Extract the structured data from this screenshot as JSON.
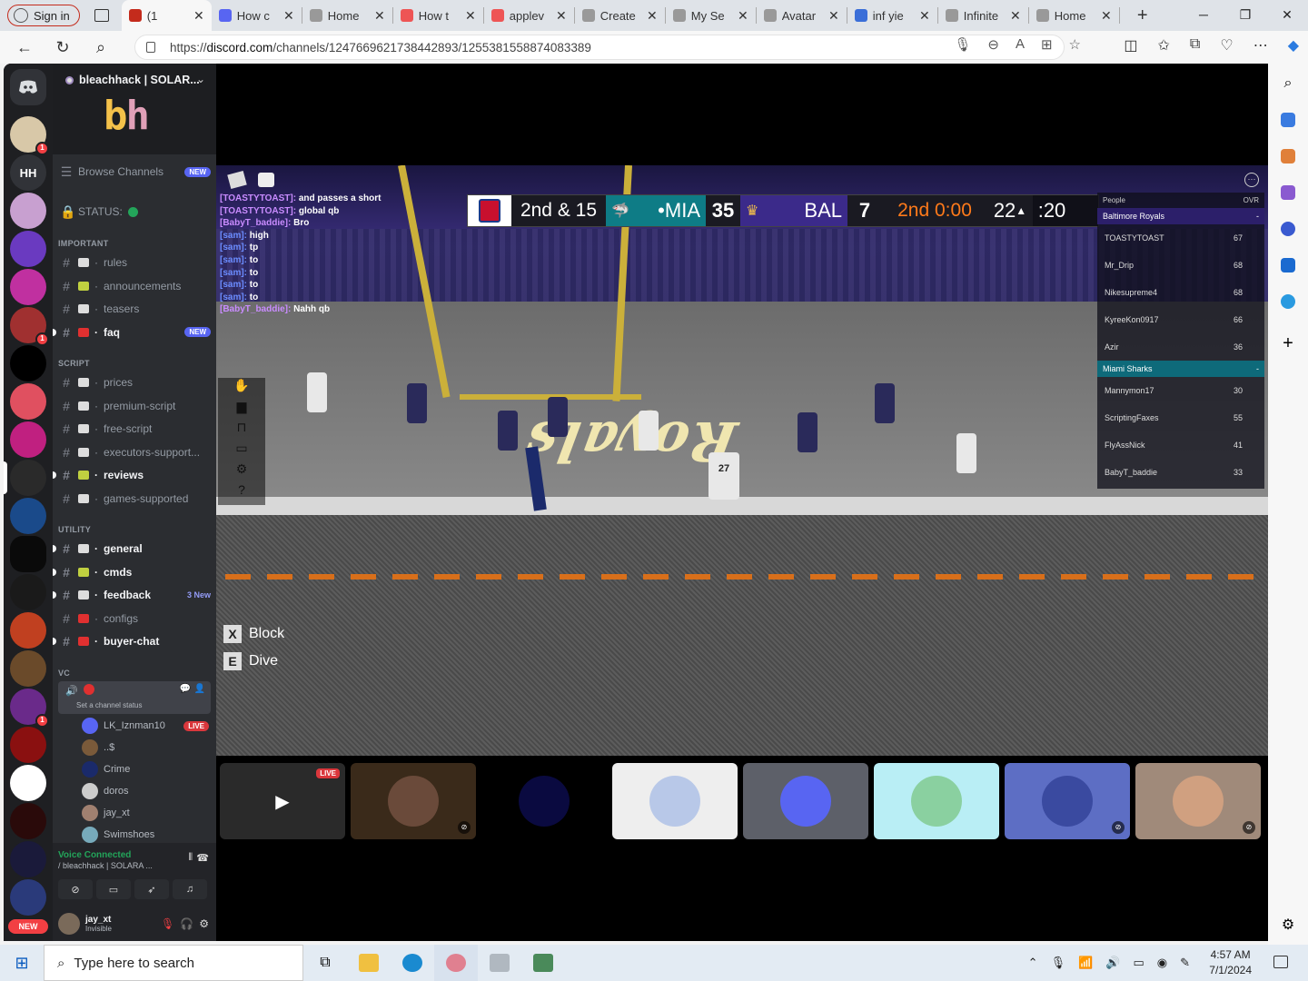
{
  "browser": {
    "signin_label": "Sign in",
    "tabs": [
      {
        "label": "(1",
        "fav": "#c42b1c",
        "active": true
      },
      {
        "label": "How c",
        "fav": "#5865f2"
      },
      {
        "label": "Home",
        "fav": "#999"
      },
      {
        "label": "How t",
        "fav": "#e55"
      },
      {
        "label": "applev",
        "fav": "#e55"
      },
      {
        "label": "Create",
        "fav": "#999"
      },
      {
        "label": "My Se",
        "fav": "#999"
      },
      {
        "label": "Avatar",
        "fav": "#999"
      },
      {
        "label": "inf yie",
        "fav": "#3a6ed8"
      },
      {
        "label": "Infinite",
        "fav": "#999"
      },
      {
        "label": "Home",
        "fav": "#999"
      }
    ],
    "url_prefix": "https://",
    "url_host": "discord.com",
    "url_path": "/channels/1247669621738442893/1255381558874083389"
  },
  "server": {
    "name": "bleachhack | SOLAR...",
    "logo_b": "b",
    "logo_h": "h",
    "home_initials": "HH",
    "new_label": "NEW"
  },
  "channels": {
    "browse": "Browse Channels",
    "browse_tag": "NEW",
    "status": "STATUS:",
    "cat_important": "IMPORTANT",
    "cat_script": "SCRIPT",
    "cat_utility": "UTILITY",
    "cat_vc": "VC",
    "important": [
      {
        "name": "rules",
        "bold": false
      },
      {
        "name": "announcements",
        "bold": false
      },
      {
        "name": "teasers",
        "bold": false
      },
      {
        "name": "faq",
        "bold": true,
        "tag": "NEW"
      }
    ],
    "script": [
      {
        "name": "prices",
        "bold": false
      },
      {
        "name": "premium-script",
        "bold": false
      },
      {
        "name": "free-script",
        "bold": false
      },
      {
        "name": "executors-support...",
        "bold": false
      },
      {
        "name": "reviews",
        "bold": true
      },
      {
        "name": "games-supported",
        "bold": false
      }
    ],
    "utility": [
      {
        "name": "general",
        "bold": true
      },
      {
        "name": "cmds",
        "bold": true
      },
      {
        "name": "feedback",
        "bold": true,
        "newcount": "3 New"
      },
      {
        "name": "configs",
        "bold": false
      },
      {
        "name": "buyer-chat",
        "bold": true
      }
    ],
    "vc_channel_status": "Set a channel status",
    "vc_members": [
      {
        "name": "LK_Iznman10",
        "live": "LIVE",
        "color": "#5865f2"
      },
      {
        "name": "..$",
        "color": "#7a5a3a"
      },
      {
        "name": "Crime",
        "color": "#1a2a6a"
      },
      {
        "name": "doros",
        "color": "#ccc"
      },
      {
        "name": "jay_xt",
        "color": "#a08070"
      },
      {
        "name": "Swimshoes",
        "color": "#7ab"
      }
    ],
    "voice_connected": "Voice Connected",
    "voice_sub": "/ bleachhack | SOLARA ...",
    "user_name": "jay_xt",
    "user_status": "Invisible"
  },
  "game": {
    "scoreboard": {
      "down": "2nd & 15",
      "team1": "MIA",
      "score1": "35",
      "team2": "BAL",
      "score2": "7",
      "quarter_time": "2nd 0:00",
      "play_clock": "22",
      "clock": ":20"
    },
    "chat": [
      {
        "who": "[TOASTYTOAST]:",
        "msg": "and passes a short"
      },
      {
        "who": "[TOASTYTOAST]:",
        "msg": "global qb"
      },
      {
        "who": "[BabyT_baddie]:",
        "msg": "Bro"
      },
      {
        "who": "[sam]:",
        "msg": "high"
      },
      {
        "who": "[sam]:",
        "msg": "tp"
      },
      {
        "who": "[sam]:",
        "msg": "to"
      },
      {
        "who": "[sam]:",
        "msg": "to"
      },
      {
        "who": "[sam]:",
        "msg": "to"
      },
      {
        "who": "[sam]:",
        "msg": "to"
      },
      {
        "who": "[BabyT_baddie]:",
        "msg": "Nahh qb"
      }
    ],
    "playerlist": {
      "header_people": "People",
      "header_ovr": "OVR",
      "team1": "Baltimore Royals",
      "team1_rows": [
        {
          "name": "TOASTYTOAST",
          "ovr": "67"
        },
        {
          "name": "Mr_Drip",
          "ovr": "68"
        },
        {
          "name": "Nikesupreme4",
          "ovr": "68"
        },
        {
          "name": "KyreeKon0917",
          "ovr": "66"
        },
        {
          "name": "Azir",
          "ovr": "36"
        }
      ],
      "team2": "Miami Sharks",
      "team2_rows": [
        {
          "name": "Mannymon17",
          "ovr": "30"
        },
        {
          "name": "ScriptingFaxes",
          "ovr": "55"
        },
        {
          "name": "FlyAssNick",
          "ovr": "41"
        },
        {
          "name": "BabyT_baddie",
          "ovr": "33"
        }
      ]
    },
    "endzone": "Royals",
    "jersey": "27",
    "hint1_key": "X",
    "hint1": "Block",
    "hint2_key": "E",
    "hint2": "Dive"
  },
  "tiles": [
    {
      "bg": "#2a2a2a",
      "live": "LIVE"
    },
    {
      "bg": "#3a2a1a",
      "face": "#6a4a3a",
      "muted": true
    },
    {
      "bg": "#000000",
      "face": "#0a0a40"
    },
    {
      "bg": "#eeeeee",
      "face": "#b8c8e8"
    },
    {
      "bg": "#5d6069",
      "face": "#5865f2"
    },
    {
      "bg": "#b9eef5",
      "face": "#8ad0a0"
    },
    {
      "bg": "#5d6ec4",
      "face": "#3a4aa0",
      "muted": true
    },
    {
      "bg": "#a08a7a",
      "face": "#d0a080",
      "muted": true
    }
  ],
  "taskbar": {
    "search_placeholder": "Type here to search",
    "time": "4:57 AM",
    "date": "7/1/2024"
  }
}
